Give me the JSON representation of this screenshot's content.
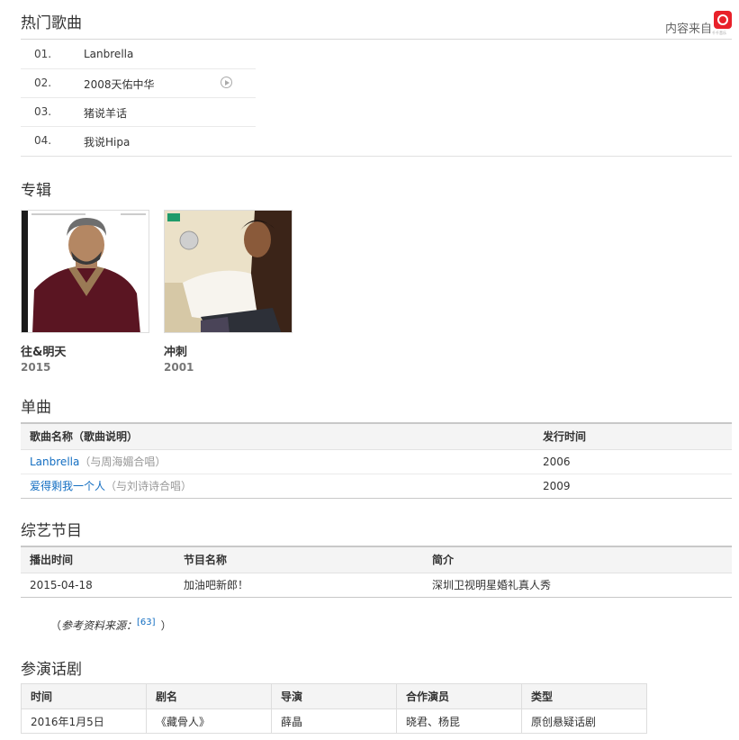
{
  "hot_songs": {
    "title": "热门歌曲",
    "source_label": "内容来自",
    "source_logo_text": "千千音乐",
    "items": [
      {
        "num": "01.",
        "name": "Lanbrella"
      },
      {
        "num": "02.",
        "name": "2008天佑中华"
      },
      {
        "num": "03.",
        "name": "猪说羊话"
      },
      {
        "num": "04.",
        "name": "我说Hipa"
      }
    ]
  },
  "albums": {
    "title": "专辑",
    "items": [
      {
        "name": "往&明天",
        "year": "2015"
      },
      {
        "name": "冲刺",
        "year": "2001"
      }
    ]
  },
  "singles": {
    "title": "单曲",
    "headers": [
      "歌曲名称（歌曲说明）",
      "发行时间"
    ],
    "rows": [
      {
        "name": "Lanbrella",
        "note": "（与周海媚合唱）",
        "year": "2006"
      },
      {
        "name": "爱得剩我一个人",
        "note": "（与刘诗诗合唱）",
        "year": "2009"
      }
    ]
  },
  "variety": {
    "title": "综艺节目",
    "headers": [
      "播出时间",
      "节目名称",
      "简介"
    ],
    "rows": [
      {
        "date": "2015-04-18",
        "program": "加油吧新郎！",
        "intro": "深圳卫视明星婚礼真人秀"
      }
    ],
    "ref_open": "（",
    "ref_label": "参考资料来源：",
    "ref_link": "[63]",
    "ref_close": "）"
  },
  "drama": {
    "title": "参演话剧",
    "headers": [
      "时间",
      "剧名",
      "导演",
      "合作演员",
      "类型"
    ],
    "rows": [
      {
        "date": "2016年1月5日",
        "name": "《藏骨人》",
        "director": "薛晶",
        "actors": "晓君、杨昆",
        "type": "原创悬疑话剧"
      }
    ]
  },
  "colors": {
    "link": "#136ec2",
    "brand": "#e8212a"
  }
}
